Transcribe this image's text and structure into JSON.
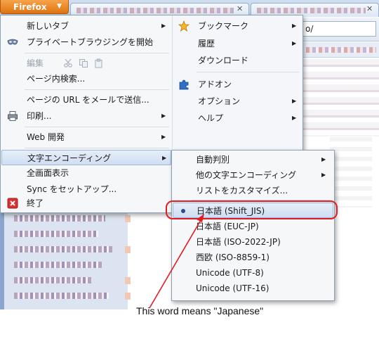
{
  "browser": {
    "firefox_button": "Firefox",
    "url_fragment": "o/"
  },
  "menu": {
    "left_items": [
      {
        "label": "新しいタブ",
        "has_submenu": true
      },
      {
        "label": "プライベートブラウジングを開始"
      },
      {
        "label": "編集",
        "disabled": true
      },
      {
        "label": "ページ内検索..."
      },
      {
        "label": "ページの URL をメールで送信..."
      },
      {
        "label": "印刷...",
        "has_submenu": true
      },
      {
        "label": "Web 開発",
        "has_submenu": true
      },
      {
        "label": "文字エンコーディング",
        "has_submenu": true,
        "highlighted": true
      },
      {
        "label": "全画面表示"
      },
      {
        "label": "Sync をセットアップ..."
      },
      {
        "label": "終了"
      }
    ],
    "right_items": [
      {
        "label": "ブックマーク",
        "has_submenu": true
      },
      {
        "label": "履歴",
        "has_submenu": true
      },
      {
        "label": "ダウンロード"
      },
      {
        "label": "アドオン"
      },
      {
        "label": "オプション",
        "has_submenu": true
      },
      {
        "label": "ヘルプ",
        "has_submenu": true
      }
    ]
  },
  "encoding_submenu": {
    "items": [
      {
        "label": "自動判別",
        "has_submenu": true
      },
      {
        "label": "他の文字エンコーディング",
        "has_submenu": true
      },
      {
        "label": "リストをカスタマイズ..."
      },
      {
        "label": "日本語 (Shift_JIS)",
        "checked": true
      },
      {
        "label": "日本語 (EUC-JP)"
      },
      {
        "label": "日本語 (ISO-2022-JP)"
      },
      {
        "label": "西欧 (ISO-8859-1)"
      },
      {
        "label": "Unicode (UTF-8)"
      },
      {
        "label": "Unicode (UTF-16)"
      }
    ]
  },
  "annotation": {
    "caption": "This word means \"Japanese\"",
    "color": "#e31b23"
  },
  "colors": {
    "firefox_orange": "#e0730f",
    "menu_highlight": "#cfdef2",
    "menu_bg": "#f6f7f9"
  }
}
